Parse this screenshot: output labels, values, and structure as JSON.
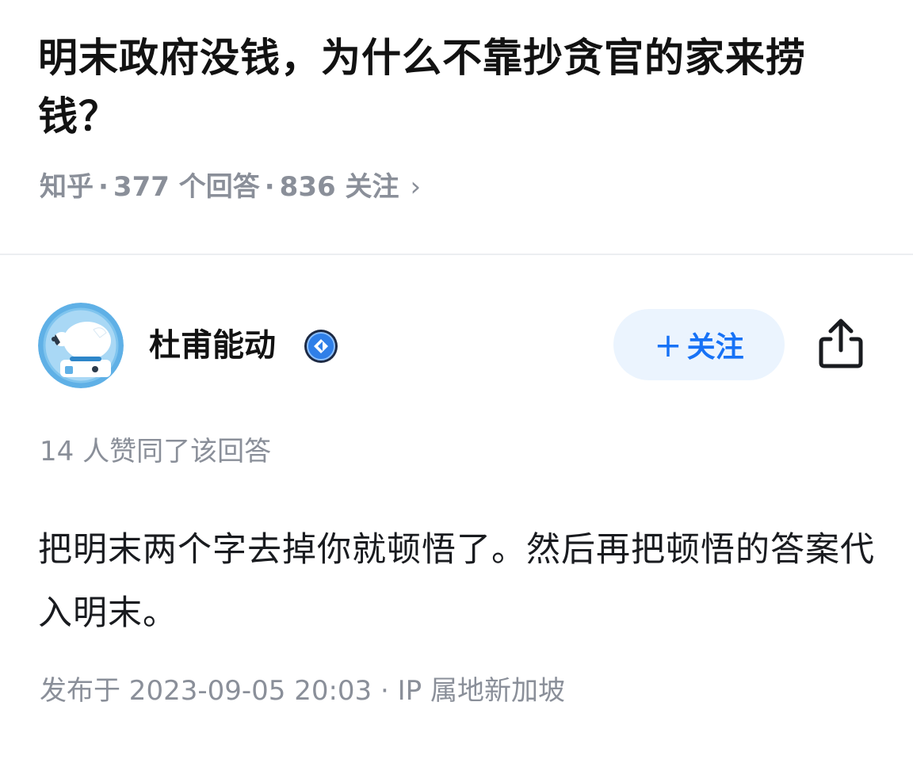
{
  "question": {
    "title": "明末政府没钱，为什么不靠抄贪官的家来捞钱？",
    "source": "知乎",
    "separator": "·",
    "answers_count": "377 个回答",
    "followers_count": "836 关注",
    "chevron": "›"
  },
  "author": {
    "name": "杜甫能动",
    "avatar_icon": "astronaut-dog-avatar",
    "badge_icon": "verified-badge-icon",
    "follow_plus": "+",
    "follow_label": "关注",
    "share_icon": "share-icon"
  },
  "answer": {
    "upvote_text": "14 人赞同了该回答",
    "body": "把明末两个字去掉你就顿悟了。然后再把顿悟的答案代入明末。",
    "publish_info": "发布于 2023-09-05 20:03 · IP 属地新加坡"
  },
  "colors": {
    "title": "#121212",
    "meta": "#8a8f99",
    "follow_bg": "#ebf4fe",
    "follow_text": "#1772f6",
    "divider": "#eceef1"
  }
}
